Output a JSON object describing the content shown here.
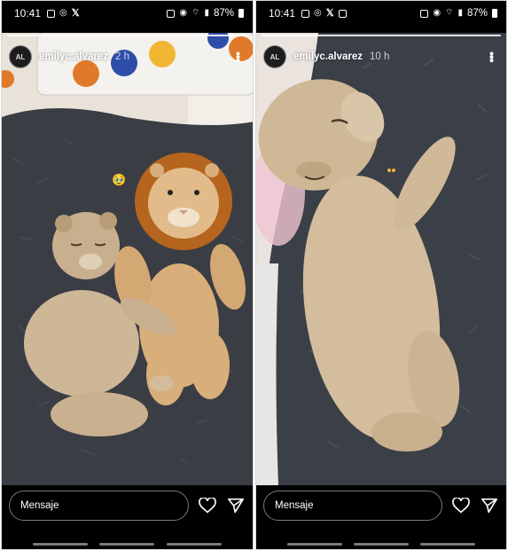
{
  "status_bar": {
    "time": "10:41",
    "battery": "87%",
    "left_icons": [
      "photo-icon",
      "whatsapp-icon",
      "x-icon"
    ],
    "left_icons_right_phone": [
      "photo-icon",
      "whatsapp-icon",
      "x-icon",
      "gallery-icon"
    ],
    "right_icons": [
      "alarm-icon",
      "mute-icon",
      "wifi-icon",
      "signal-icon",
      "battery-icon"
    ]
  },
  "stories": [
    {
      "username": "emilyc.alvarez",
      "time_ago": "2 h",
      "image": "lion cub lying next to a plush toy lion on a dark grey fluffy bed",
      "emoji": "🥹"
    },
    {
      "username": "emilyc.alvarez",
      "time_ago": "10 h",
      "image": "lion cub sleeping on its back on a dark grey fluffy bed"
    }
  ],
  "reply": {
    "placeholder": "Mensaje",
    "like_icon": "heart-icon",
    "send_icon": "send-icon"
  },
  "colors": {
    "background": "#000000",
    "text": "#ffffff",
    "border": "#7a7a7a"
  }
}
